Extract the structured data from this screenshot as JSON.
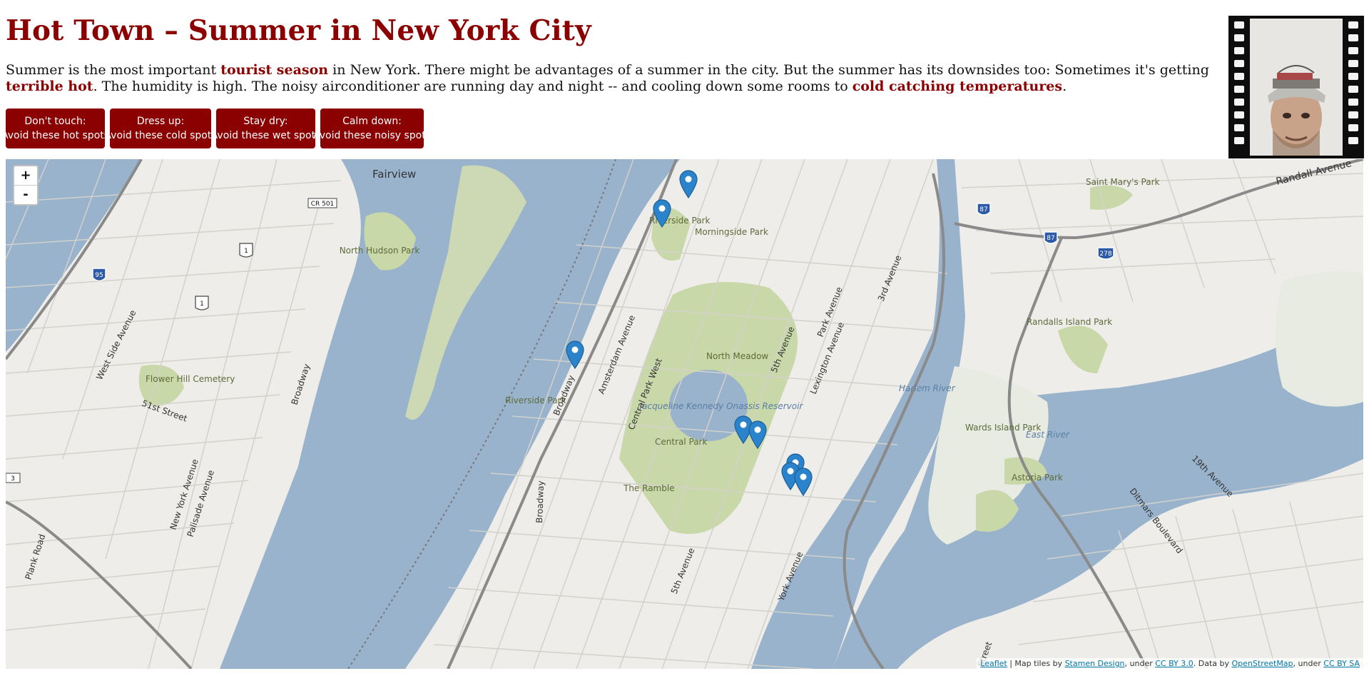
{
  "page": {
    "title": "Hot Town – Summer in New York City",
    "intro": {
      "part1": "Summer is the most important ",
      "link1": "tourist season",
      "part2": " in New York. There might be advantages of a summer in the city. But the summer has its downsides too: Sometimes it's getting ",
      "link2": "terrible hot",
      "part3": ". The humidity is high. The noisy airconditioner are running day and night -- and cooling down some rooms to ",
      "link3": "cold catching temperatures",
      "part4": "."
    }
  },
  "buttons": [
    {
      "line1": "Don't touch:",
      "line2": "Avoid these hot spots"
    },
    {
      "line1": "Dress up:",
      "line2": "Avoid these cold spots"
    },
    {
      "line1": "Stay dry:",
      "line2": "Avoid these wet spots"
    },
    {
      "line1": "Calm down:",
      "line2": "Avoid these noisy spots"
    }
  ],
  "map": {
    "zoom_in": "+",
    "zoom_out": "-",
    "marker_icon": "map-pin-icon",
    "marker_color": "#2b83cb",
    "water_color": "#99b3cc",
    "park_color": "#c9d8a8",
    "labels": {
      "fairview": "Fairview",
      "cr501": "CR 501",
      "us1": "1",
      "i95": "95",
      "i87": "87",
      "i278": "278",
      "north_hudson_park": "North Hudson Park",
      "riverside_park": "Riverside Park",
      "morningside_park": "Morningside Park",
      "saint_marys_park": "Saint Mary's Park",
      "randall_avenue": "Randall Avenue",
      "randalls_island_park": "Randalls Island Park",
      "harlem_river": "Harlem River",
      "east_river": "East River",
      "wards_island_park": "Wards Island Park",
      "astoria_park": "Astoria Park",
      "north_meadow": "North Meadow",
      "reservoir": "Jacqueline Kennedy Onassis Reservoir",
      "central_park": "Central Park",
      "the_ramble": "The Ramble",
      "flower_hill_cemetery": "Flower Hill Cemetery",
      "west_side_avenue": "West Side Avenue",
      "51st_street": "51st Street",
      "broadway": "Broadway",
      "amsterdam_avenue": "Amsterdam Avenue",
      "central_park_west": "Central Park West",
      "5th_avenue": "5th Avenue",
      "park_avenue": "Park Avenue",
      "lexington_avenue": "Lexington Avenue",
      "3rd_avenue": "3rd Avenue",
      "york_avenue": "York Avenue",
      "new_york_avenue": "New York Avenue",
      "palisade_avenue": "Palisade Avenue",
      "plank_road": "Plank Road",
      "ditmars_boulevard": "Ditmars Boulevard",
      "19th_avenue": "19th Avenue",
      "street": "Street",
      "route_3": "3"
    }
  },
  "attribution": {
    "leaflet": "Leaflet",
    "t1": " | Map tiles by ",
    "stamen": "Stamen Design",
    "t2": ", under ",
    "ccby": "CC BY 3.0",
    "t3": ". Data by ",
    "osm": "OpenStreetMap",
    "t4": ", under ",
    "ccbysa": "CC BY SA"
  }
}
